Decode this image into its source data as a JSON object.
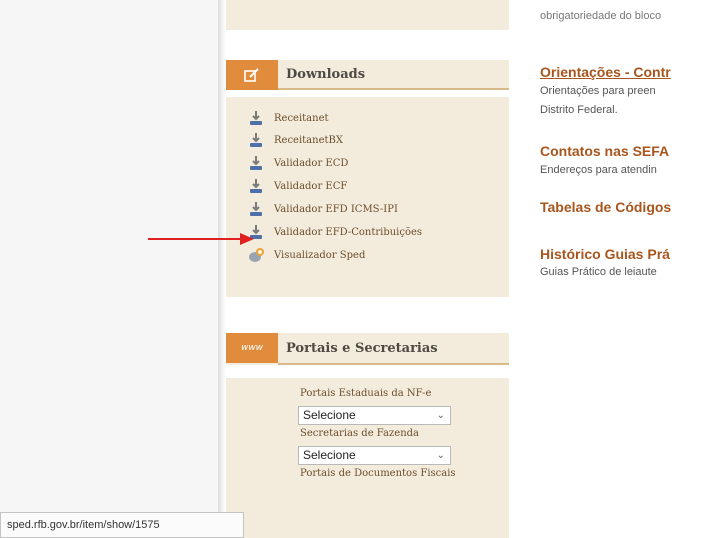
{
  "downloads": {
    "title": "Downloads",
    "items": [
      {
        "label": "Receitanet",
        "icon": "download-icon"
      },
      {
        "label": "ReceitanetBX",
        "icon": "download-icon"
      },
      {
        "label": "Validador ECD",
        "icon": "download-icon"
      },
      {
        "label": "Validador ECF",
        "icon": "download-icon"
      },
      {
        "label": "Validador EFD ICMS-IPI",
        "icon": "download-icon"
      },
      {
        "label": "Validador EFD-Contribuições",
        "icon": "download-icon"
      },
      {
        "label": "Visualizador Sped",
        "icon": "viewer-icon"
      }
    ]
  },
  "portais": {
    "badge": "www",
    "title": "Portais e Secretarias",
    "nfe_label": "Portais Estaduais da NF-e",
    "nfe_select": "Selecione",
    "fazenda_label": "Secretarias de Fazenda",
    "fazenda_select": "Selecione",
    "docs_label": "Portais de Documentos Fiscais"
  },
  "content": {
    "top_fragment": "obrigatoriedade do bloco",
    "orientacoes_title": "Orientações - Contr",
    "orientacoes_text_1": "Orientações para preen",
    "orientacoes_text_2": "Distrito Federal.",
    "contatos_title": "Contatos nas SEFA",
    "contatos_text": "Endereços para atendin",
    "tabelas_title": "Tabelas de Códigos",
    "historico_title": "Histórico Guias Prá",
    "historico_text": "Guias Prático de leiaute"
  },
  "status_bar": {
    "url": "sped.rfb.gov.br/item/show/1575"
  },
  "colors": {
    "accent_orange": "#e18c3c",
    "link_brown": "#a8561e",
    "sidebar_beige": "#f3ecdc",
    "annotation_red": "#e02020"
  }
}
